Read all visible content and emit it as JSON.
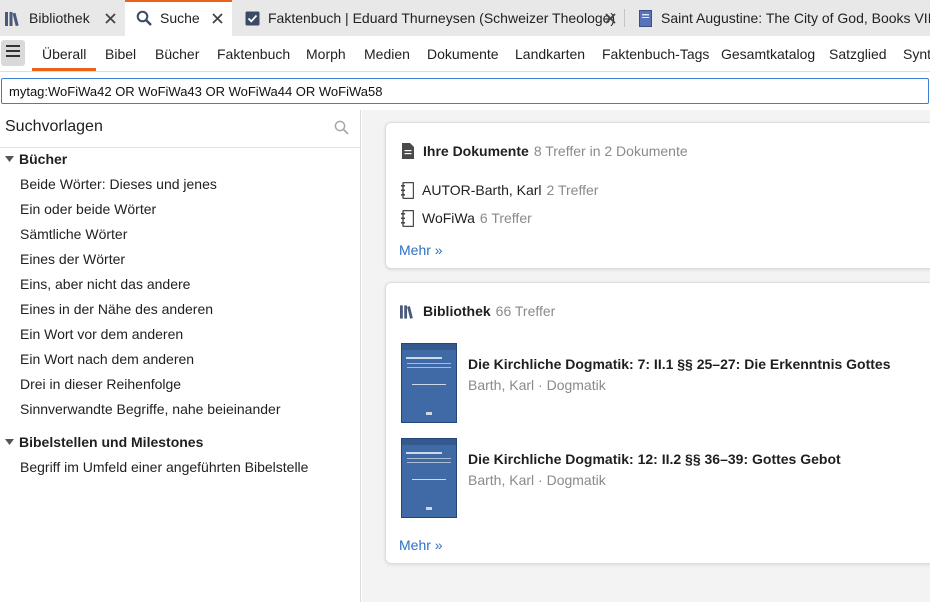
{
  "tabs": [
    {
      "label": "Bibliothek",
      "icon": "library-icon",
      "active": false
    },
    {
      "label": "Suche",
      "icon": "search-icon",
      "active": true
    },
    {
      "label": "Faktenbuch | Eduard Thurneysen (Schweizer Theologe)",
      "icon": "factbook-icon",
      "active": false
    },
    {
      "label": "Saint Augustine: The City of God, Books VIII–XVI",
      "icon": "book-icon",
      "active": false
    }
  ],
  "categories": [
    "Überall",
    "Bibel",
    "Bücher",
    "Faktenbuch",
    "Morph",
    "Medien",
    "Dokumente",
    "Landkarten",
    "Faktenbuch-Tags",
    "Gesamtkatalog",
    "Satzglied",
    "Syntax"
  ],
  "active_category": "Überall",
  "search": {
    "value": "mytag:WoFiWa42 OR WoFiWa43 OR WoFiWa44 OR WoFiWa58"
  },
  "left_panel": {
    "title": "Suchvorlagen",
    "groups": [
      {
        "label": "Bücher",
        "items": [
          "Beide Wörter: Dieses und jenes",
          "Ein oder beide Wörter",
          "Sämtliche Wörter",
          "Eines der Wörter",
          "Eins, aber nicht das andere",
          "Eines in der Nähe des anderen",
          "Ein Wort vor dem anderen",
          "Ein Wort nach dem anderen",
          "Drei in dieser Reihenfolge",
          "Sinnverwandte Begriffe, nahe beieinander"
        ]
      },
      {
        "label": "Bibelstellen und Milestones",
        "items": [
          "Begriff im Umfeld einer angeführten Bibelstelle"
        ]
      }
    ]
  },
  "documents_card": {
    "title": "Ihre Dokumente",
    "count": "8 Treffer in 2 Dokumente",
    "items": [
      {
        "name": "AUTOR-Barth, Karl",
        "count": "2 Treffer"
      },
      {
        "name": "WoFiWa",
        "count": "6 Treffer"
      }
    ],
    "more": "Mehr »"
  },
  "library_card": {
    "title": "Bibliothek",
    "count": "66 Treffer",
    "books": [
      {
        "title": "Die Kirchliche Dogmatik: 7: II.1 §§ 25–27: Die Erkenntnis Gottes",
        "subtitle": "Barth, Karl · Dogmatik"
      },
      {
        "title": "Die Kirchliche Dogmatik: 12: II.2 §§ 36–39: Gottes Gebot",
        "subtitle": "Barth, Karl · Dogmatik"
      }
    ],
    "more": "Mehr »"
  },
  "colors": {
    "accent": "#e8641b",
    "link": "#2f6fc6",
    "muted": "#8a8a8a",
    "cover": "#3f6aa5"
  }
}
